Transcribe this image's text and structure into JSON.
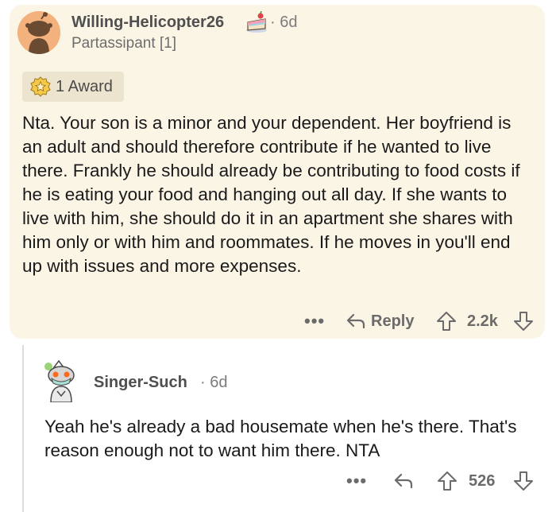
{
  "comment": {
    "username": "Willing-Helicopter26",
    "time": "6d",
    "flair": "Partassipant [1]",
    "award_label": "1 Award",
    "body": "Nta. Your son is a minor and your dependent. Her boyfriend is an adult and should therefore contribute if he wanted to live there. Frankly he should already be contributing to food costs if he is eating your food and hanging out all day. If she wants to live with him, she should do it in an apartment she shares with him only or with him and roommates. If he moves in you'll end up with issues and more expenses.",
    "more_label": "•••",
    "reply_label": "Reply",
    "vote_count": "2.2k"
  },
  "reply_comment": {
    "username": "Singer-Such",
    "time": "6d",
    "body": "Yeah he's already a bad housemate when he's there. That's reason enough not to want him there. NTA",
    "more_label": "•••",
    "vote_count": "526"
  },
  "icons": {
    "avatar": "reddit-snoo-avatar",
    "cake": "cake-day-icon",
    "award": "award-icon",
    "reply": "reply-arrow-icon",
    "upvote": "upvote-arrow-icon",
    "downvote": "downvote-arrow-icon"
  },
  "colors": {
    "card_background": "#fbf5e6",
    "avatar_orange": "#f3b27d",
    "meta_gray": "#7c7c7c",
    "action_gray": "#6b6b6b"
  }
}
